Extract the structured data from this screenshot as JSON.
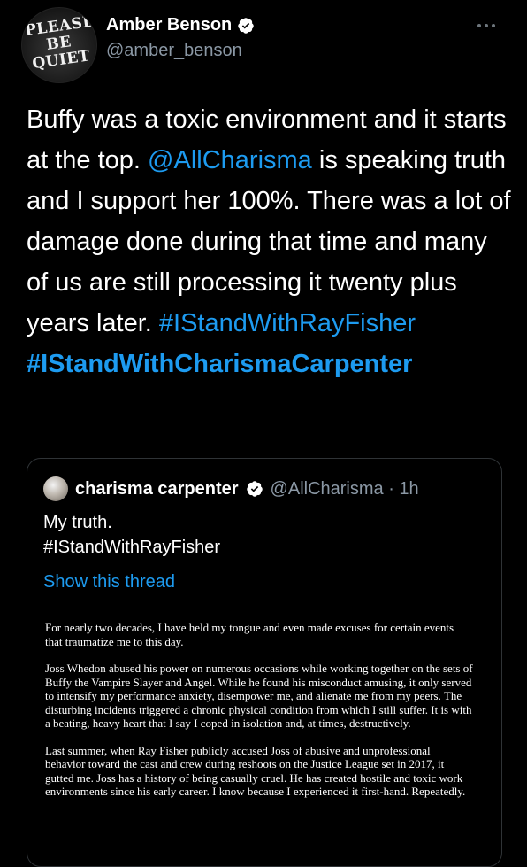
{
  "profile": {
    "avatar_sign_text": "PLEASE\nBE\nQUIET",
    "name": "Amber Benson",
    "handle": "@amber_benson"
  },
  "tweet": {
    "part1": "Buffy was a toxic environment and it starts at the top. ",
    "mention": "@AllCharisma",
    "part2": " is speaking truth and I support her 100%. There was a lot of damage done during that time and many of us are still processing it twenty plus years later. ",
    "hashtag1": "#IStandWithRayFisher",
    "hashtag2": "#IStandWithCharismaCarpenter"
  },
  "quoted": {
    "name": "charisma carpenter",
    "handle_time": "@AllCharisma · 1h",
    "line1": "My truth.",
    "line2": "#IStandWithRayFisher",
    "show_thread": "Show this thread",
    "statement": [
      "For nearly two decades, I have held my tongue and even made excuses for certain events that traumatize me to this day.",
      "Joss Whedon abused his power on numerous occasions while working together on the sets of Buffy the Vampire Slayer and Angel. While he found his misconduct amusing, it only served to intensify my performance anxiety, disempower me, and alienate me from my peers. The disturbing incidents triggered a chronic physical condition from which I still suffer. It is with a beating, heavy heart that I say I coped in isolation and, at times, destructively.",
      "Last summer, when Ray Fisher publicly accused Joss of abusive and unprofessional behavior toward the cast and crew during reshoots on the Justice League set in 2017, it gutted me. Joss has a history of being casually cruel. He has created hostile and toxic work environments since his early career. I know because I experienced it first-hand. Repeatedly."
    ]
  },
  "colors": {
    "link": "#1d9bf0",
    "background": "#000000",
    "secondary_text": "#8b98a5"
  },
  "icons": {
    "verified": "verified-badge-icon",
    "more": "more-options-icon"
  }
}
